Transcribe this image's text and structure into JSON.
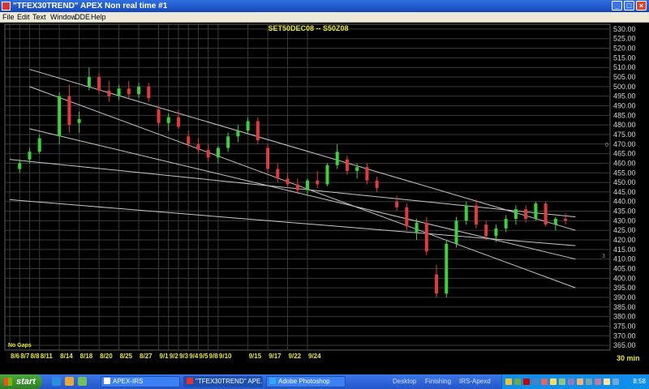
{
  "window": {
    "title": "\"TFEX30TREND\" APEX Non real time #1",
    "minimize_label": "_",
    "maximize_label": "□",
    "close_label": "×"
  },
  "menu": [
    "File",
    "Edit",
    "Text",
    "Window",
    "DDE",
    "Help"
  ],
  "chart_data": {
    "type": "candlestick",
    "title": "SET50DEC08 -- S50Z08",
    "y_ticks": [
      "530.00",
      "525.00",
      "520.00",
      "515.00",
      "510.00",
      "505.00",
      "500.00",
      "495.00",
      "490.00",
      "485.00",
      "480.00",
      "475.00",
      "470.00",
      "465.00",
      "460.00",
      "455.00",
      "450.00",
      "445.00",
      "440.00",
      "435.00",
      "430.00",
      "425.00",
      "420.00",
      "415.00",
      "410.00",
      "405.00",
      "400.00",
      "395.00",
      "390.00",
      "385.00",
      "380.00",
      "375.00",
      "370.00",
      "365.00"
    ],
    "ylim": [
      362.5,
      532.5
    ],
    "x_labels": [
      "8/6",
      "8/7",
      "8/8",
      "8/11",
      "8/14",
      "8/18",
      "8/20",
      "8/25",
      "8/27",
      "9/1",
      "9/2",
      "9/3",
      "9/4",
      "9/5",
      "9/8",
      "9/10",
      "9/15",
      "9/17",
      "9/22",
      "9/24"
    ],
    "interval_label": "30 min",
    "gap_note": "No Gaps",
    "side_markers": [
      "0",
      "3"
    ],
    "trendlines": [
      {
        "from": [
          2,
          509
        ],
        "to": [
          57,
          425
        ]
      },
      {
        "from": [
          2,
          500
        ],
        "to": [
          57,
          395
        ]
      },
      {
        "from": [
          0,
          462
        ],
        "to": [
          57,
          432
        ]
      },
      {
        "from": [
          0,
          441
        ],
        "to": [
          57,
          417
        ]
      },
      {
        "from": [
          2,
          478
        ],
        "to": [
          57,
          410
        ]
      }
    ],
    "candles": [
      {
        "o": 457,
        "h": 462,
        "l": 455,
        "c": 460
      },
      {
        "o": 462,
        "h": 468,
        "l": 460,
        "c": 466
      },
      {
        "o": 466,
        "h": 475,
        "l": 465,
        "c": 473
      },
      {
        "o": 474,
        "h": 497,
        "l": 470,
        "c": 495
      },
      {
        "o": 495,
        "h": 501,
        "l": 476,
        "c": 480
      },
      {
        "o": 481,
        "h": 487,
        "l": 476,
        "c": 483
      },
      {
        "o": 500,
        "h": 510,
        "l": 498,
        "c": 505
      },
      {
        "o": 505,
        "h": 507,
        "l": 496,
        "c": 498
      },
      {
        "o": 498,
        "h": 503,
        "l": 492,
        "c": 495
      },
      {
        "o": 495,
        "h": 501,
        "l": 493,
        "c": 499
      },
      {
        "o": 499,
        "h": 503,
        "l": 494,
        "c": 496
      },
      {
        "o": 496,
        "h": 502,
        "l": 494,
        "c": 500
      },
      {
        "o": 500,
        "h": 502,
        "l": 492,
        "c": 494
      },
      {
        "o": 488,
        "h": 490,
        "l": 479,
        "c": 481
      },
      {
        "o": 481,
        "h": 486,
        "l": 477,
        "c": 484
      },
      {
        "o": 484,
        "h": 488,
        "l": 478,
        "c": 479
      },
      {
        "o": 474,
        "h": 477,
        "l": 468,
        "c": 470
      },
      {
        "o": 470,
        "h": 473,
        "l": 465,
        "c": 467
      },
      {
        "o": 467,
        "h": 470,
        "l": 461,
        "c": 463
      },
      {
        "o": 463,
        "h": 469,
        "l": 460,
        "c": 468
      },
      {
        "o": 468,
        "h": 476,
        "l": 466,
        "c": 474
      },
      {
        "o": 474,
        "h": 480,
        "l": 471,
        "c": 477
      },
      {
        "o": 477,
        "h": 484,
        "l": 475,
        "c": 482
      },
      {
        "o": 482,
        "h": 484,
        "l": 470,
        "c": 472
      },
      {
        "o": 468,
        "h": 470,
        "l": 455,
        "c": 457
      },
      {
        "o": 457,
        "h": 460,
        "l": 450,
        "c": 452
      },
      {
        "o": 452,
        "h": 455,
        "l": 447,
        "c": 449
      },
      {
        "o": 449,
        "h": 452,
        "l": 444,
        "c": 446
      },
      {
        "o": 446,
        "h": 452,
        "l": 443,
        "c": 451
      },
      {
        "o": 451,
        "h": 456,
        "l": 447,
        "c": 449
      },
      {
        "o": 449,
        "h": 460,
        "l": 448,
        "c": 459
      },
      {
        "o": 459,
        "h": 470,
        "l": 457,
        "c": 466
      },
      {
        "o": 462,
        "h": 464,
        "l": 454,
        "c": 456
      },
      {
        "o": 456,
        "h": 460,
        "l": 452,
        "c": 458
      },
      {
        "o": 458,
        "h": 460,
        "l": 449,
        "c": 451
      },
      {
        "o": 451,
        "h": 453,
        "l": 445,
        "c": 447
      },
      {
        "o": 440,
        "h": 443,
        "l": 435,
        "c": 437
      },
      {
        "o": 437,
        "h": 439,
        "l": 425,
        "c": 427
      },
      {
        "o": 424,
        "h": 431,
        "l": 420,
        "c": 429
      },
      {
        "o": 429,
        "h": 432,
        "l": 412,
        "c": 414
      },
      {
        "o": 402,
        "h": 407,
        "l": 390,
        "c": 392
      },
      {
        "o": 392,
        "h": 420,
        "l": 390,
        "c": 418
      },
      {
        "o": 418,
        "h": 432,
        "l": 416,
        "c": 430
      },
      {
        "o": 430,
        "h": 440,
        "l": 428,
        "c": 438
      },
      {
        "o": 438,
        "h": 441,
        "l": 426,
        "c": 428
      },
      {
        "o": 428,
        "h": 430,
        "l": 420,
        "c": 422
      },
      {
        "o": 422,
        "h": 428,
        "l": 419,
        "c": 426
      },
      {
        "o": 426,
        "h": 433,
        "l": 424,
        "c": 431
      },
      {
        "o": 431,
        "h": 438,
        "l": 428,
        "c": 436
      },
      {
        "o": 436,
        "h": 438,
        "l": 429,
        "c": 431
      },
      {
        "o": 431,
        "h": 440,
        "l": 430,
        "c": 439
      },
      {
        "o": 439,
        "h": 440,
        "l": 427,
        "c": 428
      },
      {
        "o": 428,
        "h": 432,
        "l": 425,
        "c": 431
      },
      {
        "o": 431,
        "h": 434,
        "l": 428,
        "c": 430
      }
    ],
    "candle_positions": [
      1,
      2,
      3,
      5,
      6,
      7,
      8,
      9,
      10,
      11,
      12,
      13,
      14,
      15,
      16,
      17,
      18,
      19,
      20,
      21,
      22,
      23,
      24,
      25,
      26,
      27,
      28,
      29,
      30,
      31,
      32,
      33,
      34,
      35,
      36,
      37,
      39,
      40,
      41,
      42,
      43,
      44,
      45,
      46,
      47,
      48,
      49,
      50,
      51,
      52,
      53,
      54,
      55,
      56
    ],
    "x_label_positions": [
      0,
      1,
      2,
      3,
      5,
      7,
      9,
      11,
      13,
      15,
      16,
      17,
      18,
      19,
      20,
      21,
      24,
      26,
      28,
      30
    ],
    "x_max": 60,
    "colors": {
      "up": "#3cd23c",
      "down": "#e03c3c",
      "doji": "#e0d23c",
      "grid": "#3a3a3a",
      "axis_text": "#d8d8d8",
      "title": "#e8e830",
      "trendline": "#c8c8c8"
    }
  },
  "taskbar": {
    "start_label": "start",
    "buttons": [
      {
        "label": "APEX-IRS",
        "active": false
      },
      {
        "label": "\"TFEX30TREND\" APE...",
        "active": true
      },
      {
        "label": "Adobe Photoshop",
        "active": false
      }
    ],
    "tray_labels": [
      "Desktop",
      "Finishing",
      "IRS-Apexd"
    ],
    "clock": "8:58"
  }
}
